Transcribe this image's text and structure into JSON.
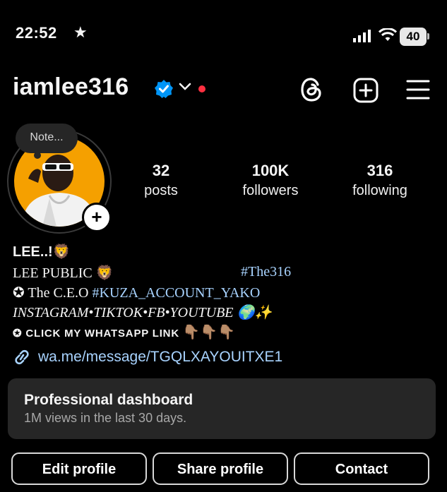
{
  "status_bar": {
    "time": "22:52",
    "star": "★",
    "battery": "40"
  },
  "header": {
    "username": "iamlee316"
  },
  "profile": {
    "note": "Note...",
    "add_story": "+",
    "stats": [
      {
        "value": "32",
        "label": "posts"
      },
      {
        "value": "100K",
        "label": "followers"
      },
      {
        "value": "316",
        "label": "following"
      }
    ]
  },
  "bio": {
    "name": "LEE..!🦁",
    "line1_text": "LEE PUBLIC 🦁",
    "line1_tag": "#The316",
    "line2_prefix": "✪ The C.E.O ",
    "line2_tag": "#KUZA_ACCOUNT_YAKO",
    "line3": "INSTAGRAM•TIKTOK•FB•YOUTUBE 🌍✨",
    "line4_prefix": "✪ ",
    "line4_text": "CLICK MY WHATSAPP LINK",
    "line4_emoji": "👇🏽👇🏽👇🏽",
    "link": "wa.me/message/TGQLXAYOUITXE1"
  },
  "dashboard": {
    "title": "Professional dashboard",
    "subtitle": "1M views in the last 30 days."
  },
  "buttons": {
    "edit": "Edit profile",
    "share": "Share profile",
    "contact": "Contact"
  },
  "colors": {
    "accent_link": "#a8d3ff",
    "verified": "#0095f6",
    "notification_dot": "#ff3040"
  }
}
